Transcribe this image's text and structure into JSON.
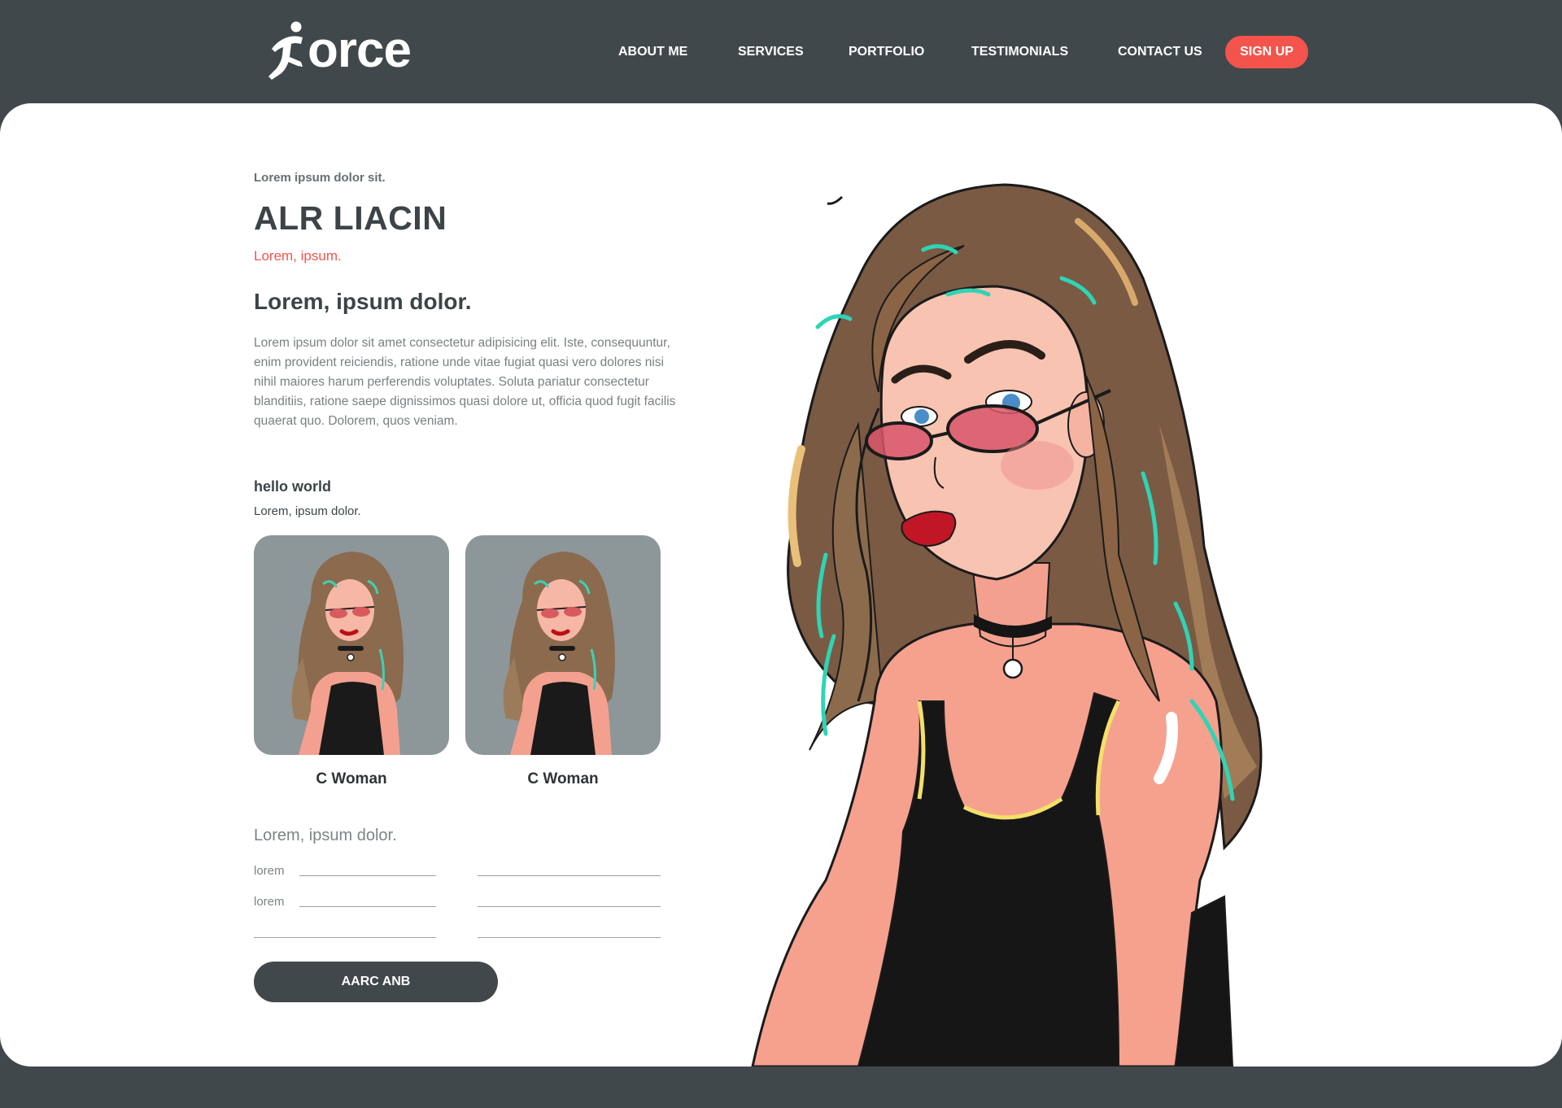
{
  "header": {
    "logo_text": "orce",
    "nav": [
      {
        "label": "ABOUT ME"
      },
      {
        "label": "SERVICES"
      },
      {
        "label": "PORTFOLIO"
      },
      {
        "label": "TESTIMONIALS"
      },
      {
        "label": "CONTACT US"
      }
    ],
    "signup_label": "SIGN UP"
  },
  "profile": {
    "eyebrow": "Lorem ipsum dolor sit.",
    "name": "ALR LIACIN",
    "subtitle": "Lorem, ipsum.",
    "heading": "Lorem, ipsum dolor.",
    "body": "Lorem ipsum dolor sit amet consectetur adipisicing elit. Iste, consequuntur, enim provident reiciendis, ratione unde vitae fugiat quasi vero dolores nisi nihil maiores harum perferendis voluptates. Soluta pariatur consectetur blanditiis, ratione saepe dignissimos quasi dolore ut, officia quod fugit facilis quaerat quo. Dolorem, quos veniam."
  },
  "gallery": {
    "heading": "hello world",
    "subheading": "Lorem, ipsum dolor.",
    "items": [
      {
        "caption": "C Woman"
      },
      {
        "caption": "C Woman"
      }
    ]
  },
  "form": {
    "heading": "Lorem, ipsum dolor.",
    "labels": [
      "lorem",
      "lorem"
    ],
    "button_label": "AARC ANB"
  },
  "colors": {
    "accent": "#f4544b",
    "dark": "#41484b",
    "card_bg": "#ffffff"
  },
  "icons": {
    "logo_mark": "running-figure-icon"
  }
}
